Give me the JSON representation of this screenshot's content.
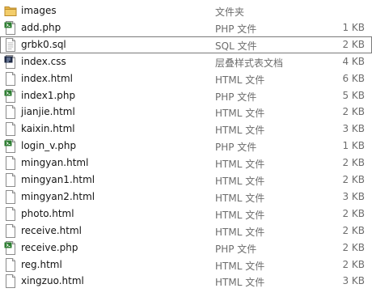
{
  "files": [
    {
      "name": "images",
      "type": "文件夹",
      "size": "",
      "icon": "folder-icon"
    },
    {
      "name": "add.php",
      "type": "PHP 文件",
      "size": "1 KB",
      "icon": "php-file-icon"
    },
    {
      "name": "grbk0.sql",
      "type": "SQL 文件",
      "size": "2 KB",
      "icon": "sql-file-icon",
      "selected": true
    },
    {
      "name": "index.css",
      "type": "层叠样式表文档",
      "size": "4 KB",
      "icon": "css-file-icon"
    },
    {
      "name": "index.html",
      "type": "HTML 文件",
      "size": "6 KB",
      "icon": "html-file-icon"
    },
    {
      "name": "index1.php",
      "type": "PHP 文件",
      "size": "5 KB",
      "icon": "php-file-icon"
    },
    {
      "name": "jianjie.html",
      "type": "HTML 文件",
      "size": "2 KB",
      "icon": "html-file-icon"
    },
    {
      "name": "kaixin.html",
      "type": "HTML 文件",
      "size": "3 KB",
      "icon": "html-file-icon"
    },
    {
      "name": "login_v.php",
      "type": "PHP 文件",
      "size": "1 KB",
      "icon": "php-file-icon"
    },
    {
      "name": "mingyan.html",
      "type": "HTML 文件",
      "size": "2 KB",
      "icon": "html-file-icon"
    },
    {
      "name": "mingyan1.html",
      "type": "HTML 文件",
      "size": "2 KB",
      "icon": "html-file-icon"
    },
    {
      "name": "mingyan2.html",
      "type": "HTML 文件",
      "size": "3 KB",
      "icon": "html-file-icon"
    },
    {
      "name": "photo.html",
      "type": "HTML 文件",
      "size": "2 KB",
      "icon": "html-file-icon"
    },
    {
      "name": "receive.html",
      "type": "HTML 文件",
      "size": "2 KB",
      "icon": "html-file-icon"
    },
    {
      "name": "receive.php",
      "type": "PHP 文件",
      "size": "2 KB",
      "icon": "php-file-icon"
    },
    {
      "name": "reg.html",
      "type": "HTML 文件",
      "size": "2 KB",
      "icon": "html-file-icon"
    },
    {
      "name": "xingzuo.html",
      "type": "HTML 文件",
      "size": "3 KB",
      "icon": "html-file-icon"
    }
  ],
  "colors": {
    "folder": "#e8b64a",
    "php_badge": "#2e7d32",
    "css_badge": "#1f2a44",
    "selection_border": "#7a7a7a"
  }
}
